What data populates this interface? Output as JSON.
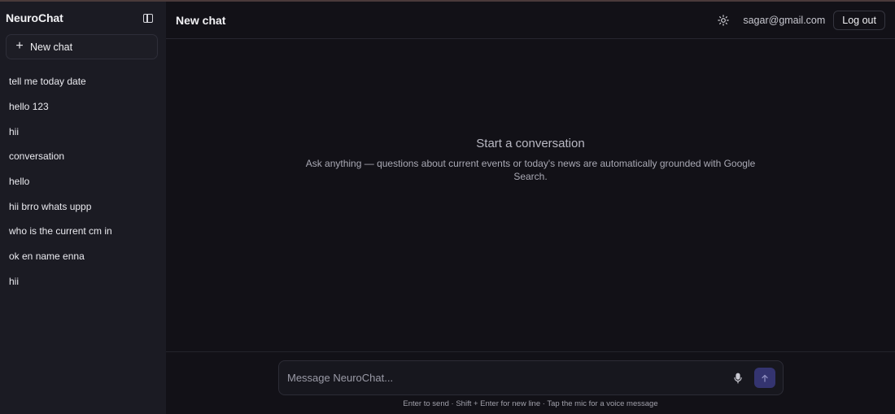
{
  "sidebar": {
    "brand": "NeuroChat",
    "new_chat_label": "New chat",
    "history": [
      {
        "label": "tell me today date"
      },
      {
        "label": "hello 123"
      },
      {
        "label": "hii"
      },
      {
        "label": "conversation"
      },
      {
        "label": "hello"
      },
      {
        "label": "hii brro whats uppp"
      },
      {
        "label": "who is the current cm in"
      },
      {
        "label": "ok en name enna"
      },
      {
        "label": "hii"
      }
    ]
  },
  "header": {
    "title": "New chat",
    "email": "sagar@gmail.com",
    "logout_label": "Log out"
  },
  "empty_state": {
    "title": "Start a conversation",
    "subtitle": "Ask anything — questions about current events or today's news are automatically grounded with Google Search."
  },
  "composer": {
    "placeholder": "Message NeuroChat...",
    "hint": "Enter to send · Shift + Enter for new line · Tap the mic for a voice message"
  },
  "icons": {
    "sidebar_toggle": "sidebar-toggle-icon",
    "new_chat": "plus-icon",
    "theme": "sun-icon",
    "mic": "mic-icon",
    "send": "arrow-up-icon"
  },
  "colors": {
    "background": "#121117",
    "sidebar": "#1b1b23",
    "send_button": "#343470"
  }
}
